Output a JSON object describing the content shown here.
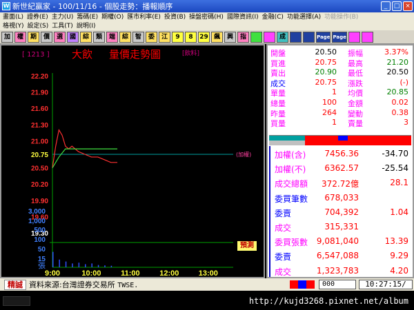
{
  "window": {
    "title": "新世紀贏家 - 100/11/16 - 個股走勢：播報順序"
  },
  "menu": {
    "row1": [
      "畫面(L)",
      "證券(E)",
      "主力(U)",
      "籌碼(E)",
      "期權(O)",
      "匯市利率(E)",
      "投資(B)",
      "操盤密碼(H)",
      "國際資訊(I)",
      "金融(C)",
      "功能選擇(A)",
      "功能操作(B)"
    ],
    "row2": [
      "格視(Y)",
      "設定(S)",
      "工具(T)",
      "說明(I)"
    ]
  },
  "toolbar": {
    "buttons": [
      "加",
      "權",
      "期",
      "價",
      "選",
      "國",
      "綜",
      "類",
      "端",
      "綜",
      "智",
      "委",
      "江",
      "9",
      "8",
      "29",
      "飆",
      "興",
      "指",
      "",
      "",
      "成",
      "",
      "",
      "Page",
      "Page",
      "",
      ""
    ]
  },
  "chart": {
    "stock_code": "[ 1213 ]",
    "stock_name": "大飲",
    "title": "量價走勢圖",
    "sector": "[飲料]",
    "cap_badge": "預測",
    "ref_label": "(加權)",
    "price_ticks": [
      "22.20",
      "21.90",
      "21.60",
      "21.30",
      "21.00",
      "20.75",
      "20.50",
      "20.20",
      "19.90",
      "19.60",
      "19.30"
    ],
    "volume_ticks": [
      "3,000",
      "1,000",
      "500",
      "100",
      "50",
      "15"
    ],
    "volume_unit": "張",
    "time_ticks": [
      "9:00",
      "10:00",
      "11:00",
      "12:00",
      "13:00"
    ]
  },
  "chart_data": {
    "type": "line",
    "title": "量價走勢圖",
    "xlabel": "",
    "ylabel": "",
    "x_range": [
      "9:00",
      "13:30"
    ],
    "ylim": [
      19.3,
      22.2
    ],
    "reference_price": 20.75,
    "series": [
      {
        "x": [
          "9:00",
          "9:05",
          "9:10",
          "9:15",
          "9:20",
          "9:25",
          "9:30",
          "9:40",
          "9:50",
          "10:00",
          "10:10",
          "10:20",
          "10:30",
          "10:40"
        ],
        "values": [
          20.5,
          20.9,
          21.2,
          21.1,
          20.9,
          20.85,
          20.9,
          20.8,
          20.75,
          20.7,
          20.7,
          20.65,
          20.6,
          20.6
        ]
      },
      {
        "x": [
          "9:00",
          "9:10",
          "9:20",
          "9:30",
          "9:40",
          "9:50",
          "10:00",
          "10:10",
          "10:20",
          "10:30",
          "10:40"
        ],
        "values": [
          20.5,
          20.7,
          20.85,
          20.85,
          20.85,
          20.85,
          20.85,
          20.85,
          20.85,
          20.85,
          20.85
        ]
      }
    ],
    "volume": {
      "x": [
        "9:00",
        "9:10",
        "9:20",
        "9:30",
        "9:40",
        "9:50",
        "10:00",
        "10:10",
        "10:20",
        "10:30"
      ],
      "values": [
        40,
        20,
        15,
        10,
        12,
        8,
        10,
        6,
        5,
        4
      ]
    }
  },
  "quote": {
    "rows": [
      {
        "l1": "開盤",
        "v1": "20.50",
        "l2": "振幅",
        "v2": "3.37%",
        "c1": "#ff00ff",
        "cv1": "#000000",
        "c2": "#ff00ff",
        "cv2": "#ff0000"
      },
      {
        "l1": "買進",
        "v1": "20.75",
        "l2": "最高",
        "v2": "21.20",
        "c1": "#ff00ff",
        "cv1": "#ff0000",
        "c2": "#ff00ff",
        "cv2": "#008000"
      },
      {
        "l1": "賣出",
        "v1": "20.90",
        "l2": "最低",
        "v2": "20.50",
        "c1": "#ff00ff",
        "cv1": "#008000",
        "c2": "#ff00ff",
        "cv2": "#000000"
      },
      {
        "l1": "成交",
        "v1": "20.75",
        "l2": "漲跌",
        "v2": "(-)",
        "c1": "#0000ff",
        "cv1": "#ff0000",
        "c2": "#ff00ff",
        "cv2": "#ff0000"
      },
      {
        "l1": "單量",
        "v1": "1",
        "l2": "均價",
        "v2": "20.85",
        "c1": "#ff00ff",
        "cv1": "#ff0000",
        "c2": "#ff00ff",
        "cv2": "#008000"
      },
      {
        "l1": "總量",
        "v1": "100",
        "l2": "金額",
        "v2": "0.02",
        "c1": "#ff00ff",
        "cv1": "#ff0000",
        "c2": "#ff00ff",
        "cv2": "#ff0000"
      },
      {
        "l1": "昨量",
        "v1": "264",
        "l2": "變動",
        "v2": "0.38",
        "c1": "#ff00ff",
        "cv1": "#ff0000",
        "c2": "#ff00ff",
        "cv2": "#ff0000"
      },
      {
        "l1": "買量",
        "v1": "1",
        "l2": "賣量",
        "v2": "3",
        "c1": "#ff00ff",
        "cv1": "#ff0000",
        "c2": "#ff00ff",
        "cv2": "#ff0000"
      }
    ],
    "index_rows": [
      {
        "label": "加權(含)",
        "value": "7456.36",
        "change": "-34.70",
        "cl": "#ff00ff",
        "cv": "#ff0000",
        "cc": "#000000"
      },
      {
        "label": "加權(不)",
        "value": "6362.57",
        "change": "-25.54",
        "cl": "#ff00ff",
        "cv": "#ff0000",
        "cc": "#000000"
      },
      {
        "label": "成交總額",
        "value": "372.72億",
        "change": "28.1",
        "cl": "#ff00ff",
        "cv": "#ff0000",
        "cc": "#ff0000"
      },
      {
        "label": "委買筆數",
        "value": "678,033",
        "change": "",
        "cl": "#0000ff",
        "cv": "#ff0000",
        "cc": "#ff0000"
      },
      {
        "label": "委賣",
        "value": "704,392",
        "change": "1.04",
        "cl": "#0000ff",
        "cv": "#ff0000",
        "cc": "#ff0000"
      },
      {
        "label": "成交",
        "value": "315,331",
        "change": "",
        "cl": "#ff00ff",
        "cv": "#ff0000",
        "cc": "#ff0000"
      },
      {
        "label": "委買張數",
        "value": "9,081,040",
        "change": "13.39",
        "cl": "#ff00ff",
        "cv": "#ff0000",
        "cc": "#ff0000"
      },
      {
        "label": "委賣",
        "value": "6,547,088",
        "change": "9.29",
        "cl": "#0000ff",
        "cv": "#ff0000",
        "cc": "#ff0000"
      },
      {
        "label": "成交",
        "value": "1,323,783",
        "change": "4.20",
        "cl": "#ff00ff",
        "cv": "#ff0000",
        "cc": "#ff0000"
      }
    ]
  },
  "status": {
    "tag": "精誠",
    "source": "資料來源:台灣證券交易所",
    "source_code": "TWSE.",
    "input_value": "000",
    "time": "10:27:15/"
  },
  "watermark": "http://kujd3268.pixnet.net/album",
  "colors": {
    "price_line": "#ff3030",
    "avg_line": "#40e040",
    "ref_line": "#00a0a0",
    "grid": "#00a000",
    "volume_bar": "#3050ff"
  }
}
